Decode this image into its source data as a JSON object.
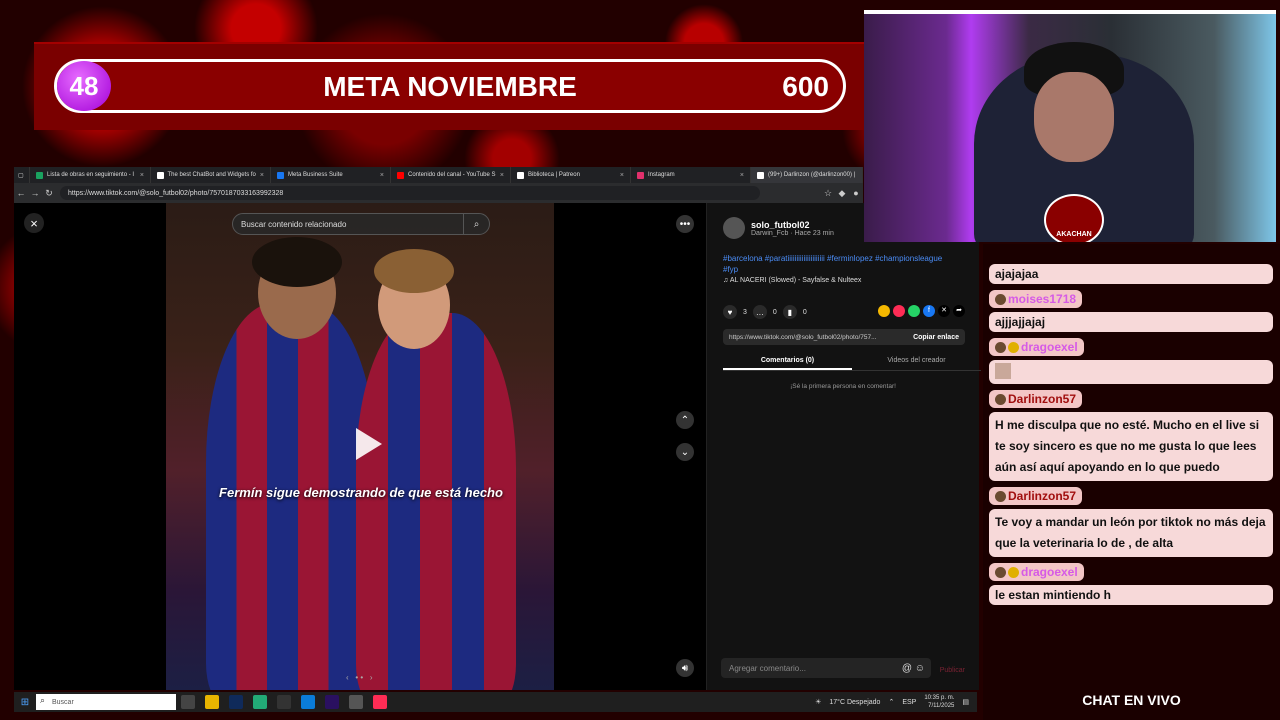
{
  "goal": {
    "current": "48",
    "title": "META NOVIEMBRE",
    "target": "600"
  },
  "browser": {
    "tabs": [
      {
        "label": "Lista de obras en seguimiento - I",
        "color": "#1aa260"
      },
      {
        "label": "The best ChatBot and Widgets fo",
        "color": "#ffffff"
      },
      {
        "label": "Meta Business Suite",
        "color": "#1877f2"
      },
      {
        "label": "Contenido del canal - YouTube S",
        "color": "#ff0000"
      },
      {
        "label": "Biblioteca | Patreon",
        "color": "#ffffff"
      },
      {
        "label": "Instagram",
        "color": "#e1306c"
      },
      {
        "label": "(99+) Darlinzon (@darlinzon00) |",
        "color": "#ffffff"
      }
    ],
    "url": "https://www.tiktok.com/@solo_futbol02/photo/7570187033163992328"
  },
  "tiktok": {
    "search_placeholder": "Buscar contenido relacionado",
    "caption": "Fermín sigue demostrando de que está hecho",
    "author": {
      "name": "solo_futbol02",
      "sub": "Darwin_Fcb · Hace 23 min"
    },
    "tags": "#barcelona #paratiiiiiiiiiiiiiiiiiiiii #ferminlopez #championsleague #fyp",
    "music": "AL NACERI (Slowed) - Sayfalse & Nulteex",
    "likes": "3",
    "comments": "0",
    "saves": "0",
    "link": "https://www.tiktok.com/@solo_futbol02/photo/757...",
    "copy_label": "Copiar enlace",
    "tab_comments": "Comentarios (0)",
    "tab_videos": "Videos del creador",
    "empty_note": "¡Sé la primera persona en comentar!",
    "comment_placeholder": "Agregar comentario...",
    "post_label": "Publicar"
  },
  "taskbar": {
    "search_placeholder": "Buscar",
    "weather": "17°C Despejado",
    "lang": "ESP",
    "time": "10:35 p. m.",
    "date": "7/11/2025"
  },
  "cam": {
    "logo_text": "AKACHAN"
  },
  "chat": {
    "messages": [
      {
        "user": "",
        "text": "ajajajaa"
      },
      {
        "user": "moises1718",
        "text": "ajjjajjajaj"
      },
      {
        "user": "dragoexel",
        "text": ""
      },
      {
        "user": "Darlinzon57",
        "text": "H me disculpa que no esté. Mucho en el live si te soy sincero es que no me gusta lo que lees aún así aquí apoyando en lo que puedo"
      },
      {
        "user": "Darlinzon57",
        "text": "Te voy a mandar un león por tiktok no más deja que la veterinaria lo de , de alta"
      },
      {
        "user": "dragoexel",
        "text": "le estan mintiendo h"
      }
    ],
    "footer": "CHAT EN VIVO"
  },
  "colors": {
    "accent": "#fe2c55",
    "goal_bg": "#7a0000",
    "goal_badge": "#c030f0",
    "chat_bubble": "#f7d9d9"
  }
}
